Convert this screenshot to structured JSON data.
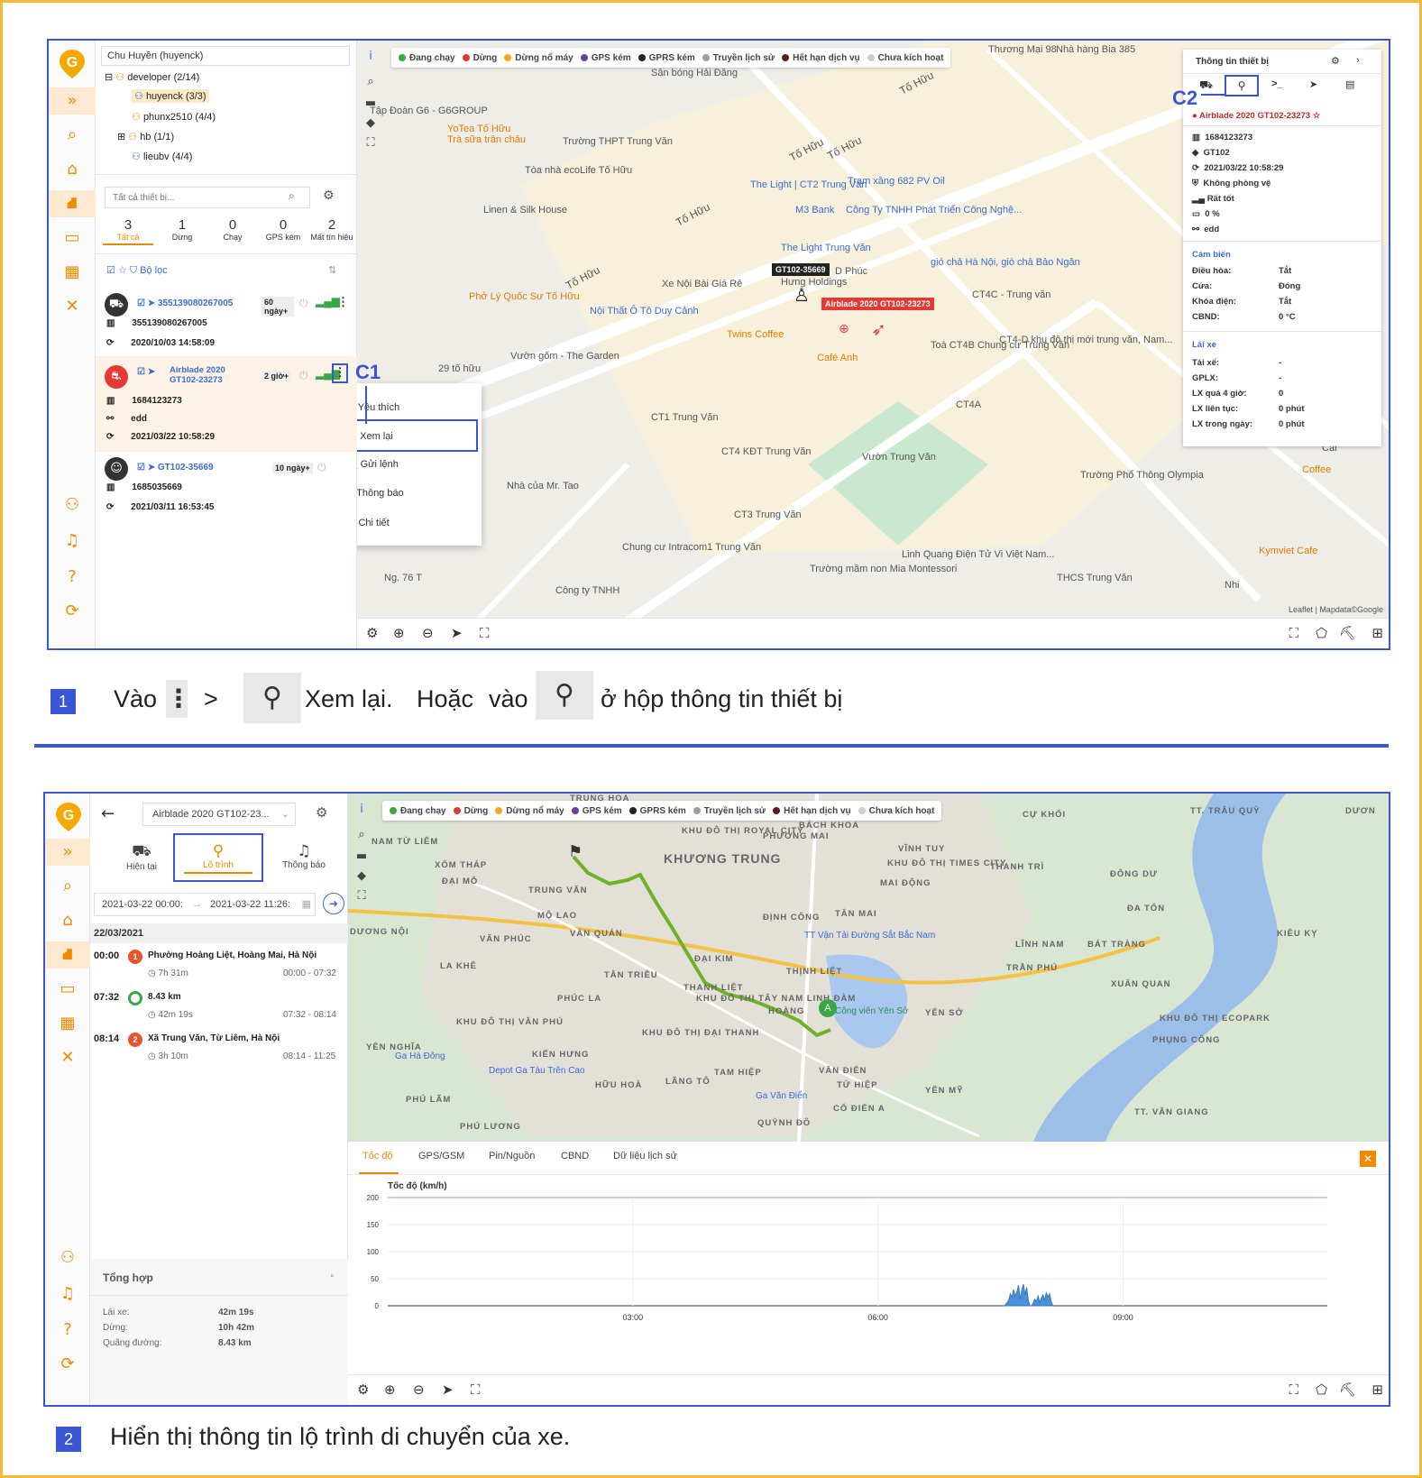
{
  "steps": [
    {
      "num": "1",
      "t1": "Vào",
      "t2": ">",
      "t3": "Xem lại.",
      "t4": "Hoặc",
      "t5": "vào",
      "t6": "ở hộp thông tin thiết bị"
    },
    {
      "num": "2",
      "text": "Hiển thị thông tin lộ trình di chuyển của xe."
    }
  ],
  "callouts": {
    "c1": "C1",
    "c2": "C2"
  },
  "legend": [
    {
      "label": "Đang chạy",
      "color": "#3aa648"
    },
    {
      "label": "Dừng",
      "color": "#e53935"
    },
    {
      "label": "Dừng nổ máy",
      "color": "#f5a623"
    },
    {
      "label": "GPS kém",
      "color": "#6a3fa0"
    },
    {
      "label": "GPRS kém",
      "color": "#222222"
    },
    {
      "label": "Truyền lịch sử",
      "color": "#9e9e9e"
    },
    {
      "label": "Hết hạn dịch vụ",
      "color": "#5a1e1e"
    },
    {
      "label": "Chưa kích hoạt",
      "color": "#d0d0d0"
    }
  ],
  "s1": {
    "tree": {
      "root": "Chu Huyền (huyenck)",
      "items": [
        "developer (2/14)",
        "huyenck (3/3)",
        "phunx2510 (4/4)",
        "hb (1/1)",
        "lieubv (4/4)"
      ]
    },
    "search": {
      "placeholder": "Tất cả thiết bị..."
    },
    "counts": [
      {
        "n": "3",
        "label": "Tất cả"
      },
      {
        "n": "1",
        "label": "Dừng"
      },
      {
        "n": "0",
        "label": "Chạy"
      },
      {
        "n": "0",
        "label": "GPS kém"
      },
      {
        "n": "2",
        "label": "Mất tín hiệu"
      }
    ],
    "filter": "Bộ lọc",
    "devices": [
      {
        "name": "355139080267005",
        "badge": "60 ngày+",
        "id": "355139080267005",
        "time": "2020/10/03 14:58:09"
      },
      {
        "name": "Airblade 2020 GT102-23273",
        "badge": "2 giờ+",
        "id": "1684123273",
        "extra": "edd",
        "time": "2021/03/22 10:58:29"
      },
      {
        "name": "GT102-35669",
        "badge": "10 ngày+",
        "id": "1685035669",
        "time": "2021/03/11 16:53:45"
      }
    ],
    "menu": [
      "Yêu thích",
      "Xem lại",
      "Gửi lệnh",
      "Thông báo",
      "Chi tiết"
    ],
    "map_labels": [
      "Tập Đoàn G6 - G6GROUP",
      "YoTea Tố Hữu",
      "Trà sữa trân châu",
      "Trường THPT Trung Văn",
      "Tòa nhà ecoLife Tố Hữu",
      "Linen & Silk House",
      "Sân bóng Hải Đăng",
      "Nhà hàng Bia 385",
      "Thương Mại 98",
      "The Light | CT2 Trung Văn",
      "M3 Bank",
      "Công Ty TNHH Phát Triển Công Nghệ...",
      "Trạm xăng 682 PV Oil",
      "The Light Trung Văn",
      "Xe Nội Bài Giá Rẻ",
      "Phở Lý Quốc Sư Tố Hữu",
      "Nội Thất Ô Tô Duy Cảnh",
      "gió chả Hà Nội, giò chả Bảo Ngân",
      "CT4C - Trung văn",
      "Twins Coffee",
      "Café Anh",
      "Vườn gốm - The Garden",
      "29 tố hữu",
      "Toà CT4B Chung cư Trung Văn",
      "CT4-D khu đô thị mới trung văn, Nam...",
      "CT1 Trung Văn",
      "CT4 KĐT Trung Văn",
      "CT4A",
      "Vườn Trung Văn",
      "Nhà của Mr. Tao",
      "CT3 Trung Văn",
      "Chung cư Intracom1 Trung Văn",
      "Linh Quang Điện Tử Vi Việt Nam...",
      "Trường mầm non Mia Montessori",
      "THCS Trung Văn",
      "Trường Phổ Thông Olympia",
      "Kymviet Cafe",
      "Coffee",
      "Tố Hữu",
      "Tố Hữu",
      "Tố Hữu",
      "Tố Hữu",
      "Tố Hữu",
      "D Phúc",
      "Hưng Holdings",
      "Công ty TNHH",
      "Ng. 76 T",
      "Nhi",
      "Caf"
    ],
    "map_marker1": "GT102-35669",
    "map_marker2": "Airblade 2020 GT102-23273",
    "attribution": "Leaflet | Mapdata©Google",
    "info": {
      "title": "Thông tin thiết bị",
      "vehicle": "Airblade 2020 GT102-23273",
      "rows": [
        "1684123273",
        "GT102",
        "2021/03/22 10:58:29",
        "Không phòng vệ",
        "Rất tốt",
        "0 %",
        "edd"
      ],
      "sensor_title": "Cảm biến",
      "sensors": [
        {
          "k": "Điều hòa:",
          "v": "Tắt"
        },
        {
          "k": "Cửa:",
          "v": "Đóng"
        },
        {
          "k": "Khóa điện:",
          "v": "Tắt"
        },
        {
          "k": "CBND:",
          "v": "0 °C"
        }
      ],
      "driver_title": "Lái xe",
      "driver": [
        {
          "k": "Tài xế:",
          "v": "-"
        },
        {
          "k": "GPLX:",
          "v": "-"
        },
        {
          "k": "LX quá 4 giờ:",
          "v": "0"
        },
        {
          "k": "LX liên tục:",
          "v": "0 phút"
        },
        {
          "k": "LX trong ngày:",
          "v": "0 phút"
        }
      ]
    }
  },
  "s2": {
    "device_select": "Airblade 2020 GT102-23...",
    "tabs": [
      "Hiện tại",
      "Lộ trình",
      "Thông báo"
    ],
    "date_from": "2021-03-22 00:00:",
    "date_to": "2021-03-22 11:26:",
    "day": "22/03/2021",
    "entries": [
      {
        "time": "00:00",
        "num": "1",
        "place": "Phường Hoàng Liệt, Hoàng Mai, Hà Nội",
        "dur": "7h 31m",
        "range": "00:00 - 07:32"
      },
      {
        "time": "07:32",
        "num": "",
        "place": "8.43 km",
        "dur": "42m 19s",
        "range": "07:32 - 08:14"
      },
      {
        "time": "08:14",
        "num": "2",
        "place": "Xã Trung Văn, Từ Liêm, Hà Nội",
        "dur": "3h 10m",
        "range": "08:14 - 11:25"
      }
    ],
    "summary_title": "Tổng hợp",
    "summary": [
      {
        "k": "Lái xe:",
        "v": "42m 19s"
      },
      {
        "k": "Dừng:",
        "v": "10h 42m"
      },
      {
        "k": "Quãng đường:",
        "v": "8.43 km"
      }
    ],
    "map_labels": [
      "KHƯƠNG TRUNG",
      "KHU ĐÔ THỊ ROYAL CITY",
      "PHƯƠNG MAI",
      "BÁCH KHOA",
      "VĨNH TUY",
      "KHU ĐÔ THỊ TIMES CITY",
      "MAI ĐỘNG",
      "THANH TRÌ",
      "CỰ KHỐI",
      "TT. TRÂU QUỲ",
      "NAM TỪ LIÊM",
      "XỐM THÁP",
      "ĐẠI MỖ",
      "TRUNG VĂN",
      "MỘ LAO",
      "VĂN PHÚC",
      "VĂN QUÁN",
      "ĐỊNH CÔNG",
      "TÂN MAI",
      "ĐÔNG DƯ",
      "ĐA TỐN",
      "KIÊU KỴ",
      "DƯƠNG NỘI",
      "LA KHÊ",
      "TÂN TRIỀU",
      "ĐẠI KIM",
      "THỊNH LIỆT",
      "LĨNH NAM",
      "BÁT TRÀNG",
      "TRẦN PHÚ",
      "XUÂN QUAN",
      "THANH LIỆT",
      "PHÚC LA",
      "HOÀNG",
      "YÊN SỞ",
      "KHU ĐÔ THỊ TÂY NAM LINH ĐÀM",
      "KHU ĐÔ THỊ VĂN PHÚ",
      "KHU ĐÔ THỊ ĐẠI THANH",
      "KIẾN HƯNG",
      "YÊN NGHĨA",
      "Ga Hà Đông",
      "Depot Ga Tàu Trên Cao",
      "HỮU HOÀ",
      "LÃNG TÔ",
      "TAM HIỆP",
      "VĂN ĐIỂN",
      "TỨ HIỆP",
      "Ga Văn Điển",
      "CỔ ĐIỂN A",
      "PHÚ LÃM",
      "PHÚ LƯƠNG",
      "QUỲNH ĐÔ",
      "YÊN MỸ",
      "TT. VĂN GIANG",
      "PHỤNG CÔNG",
      "KHU ĐÔ THỊ ECOPARK",
      "DƯƠN",
      "TRUNG HOA",
      "TT Vận Tải Đường Sắt Bắc Nam",
      "Công viên Yên Sở"
    ],
    "chart_tabs": [
      "Tốc độ",
      "GPS/GSM",
      "Pin/Nguồn",
      "CBND",
      "Dữ liệu lịch sử"
    ],
    "chart_data": {
      "type": "area",
      "title": "Tốc độ (km/h)",
      "xlabel": "",
      "ylabel": "Tốc độ (km/h)",
      "ylim": [
        0,
        200
      ],
      "yticks": [
        0,
        50,
        100,
        150,
        200
      ],
      "xticks": [
        "03:00",
        "06:00",
        "09:00"
      ],
      "x_hours_range": [
        0,
        11.5
      ],
      "series": [
        {
          "x": [
            7.55,
            7.6,
            7.62,
            7.64,
            7.66,
            7.68,
            7.7,
            7.72,
            7.74,
            7.76,
            7.78,
            7.8,
            7.82,
            7.84,
            7.86,
            7.88,
            7.9,
            7.92,
            7.94,
            7.96,
            7.98,
            8.0,
            8.02,
            8.04,
            8.06,
            8.08,
            8.1,
            8.12,
            8.14
          ],
          "values": [
            0,
            10,
            22,
            15,
            30,
            18,
            25,
            38,
            12,
            28,
            40,
            20,
            34,
            10,
            0,
            0,
            5,
            12,
            8,
            18,
            6,
            14,
            20,
            10,
            24,
            16,
            22,
            8,
            0
          ]
        }
      ]
    }
  }
}
